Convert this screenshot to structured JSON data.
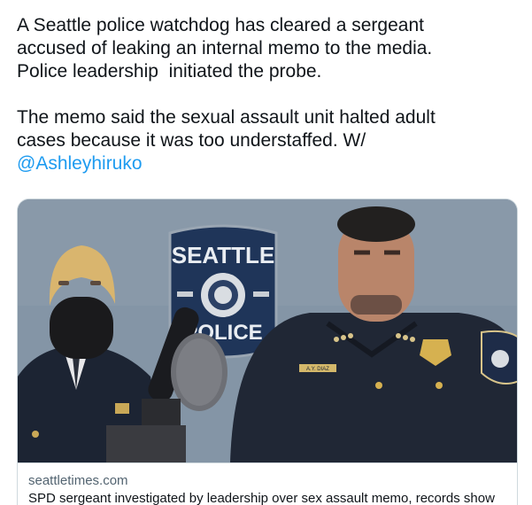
{
  "tweet": {
    "line1": "A Seattle police watchdog has cleared a sergeant",
    "line2": "accused of leaking an internal memo to the media.",
    "line3": "Police leadership  initiated the probe.",
    "line4": "The memo said the sexual assault unit halted adult",
    "line5": "cases because it was too understaffed. W/",
    "mention": "@Ashleyhiruko"
  },
  "card": {
    "domain": "seattletimes.com",
    "headline": "SPD sergeant investigated by leadership over sex assault memo, records show",
    "image": {
      "badge_top": "SEATTLE",
      "badge_bottom": "POLICE",
      "shoulder_patch": "SEATTLE POLICE",
      "name_plate": "A.Y. DIAZ"
    }
  },
  "colors": {
    "text": "#0f1419",
    "link": "#1d9bf0",
    "muted": "#536471",
    "border": "#cfd9de"
  }
}
